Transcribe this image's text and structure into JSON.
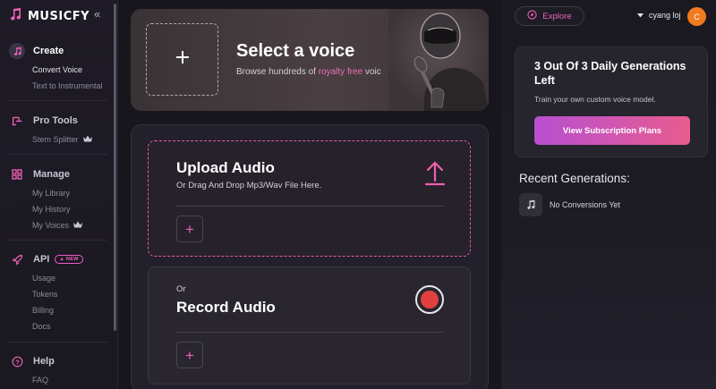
{
  "app": {
    "name": "MUSICFY"
  },
  "sidebar": {
    "sections": [
      {
        "title": "Create",
        "items": [
          "Convert Voice",
          "Text to Instrumental"
        ]
      },
      {
        "title": "Pro Tools",
        "items": [
          "Stem Splitter"
        ]
      },
      {
        "title": "Manage",
        "items": [
          "My Library",
          "My History",
          "My Voices"
        ]
      },
      {
        "title": "API",
        "badge": "NEW",
        "items": [
          "Usage",
          "Tokens",
          "Billing",
          "Docs"
        ]
      },
      {
        "title": "Help",
        "items": [
          "FAQ"
        ]
      }
    ]
  },
  "hero": {
    "title": "Select a voice",
    "subtitle_pre": "Browse hundreds of ",
    "subtitle_link": "royalty free",
    "subtitle_post": " voic"
  },
  "upload": {
    "title": "Upload Audio",
    "subtitle": "Or Drag And Drop Mp3/Wav File Here.",
    "add_label": "+"
  },
  "record": {
    "prefix": "Or",
    "title": "Record Audio",
    "add_label": "+"
  },
  "header": {
    "explore_label": "Explore",
    "username": "cyang loj",
    "avatar_initial": "C"
  },
  "generations": {
    "title": "3 Out Of 3 Daily Generations Left",
    "subtitle": "Train your own custom voice model.",
    "button_label": "View Subscription Plans"
  },
  "recent": {
    "title": "Recent Generations:",
    "empty_text": "No Conversions Yet"
  },
  "colors": {
    "accent_pink": "#ef5fb2",
    "record_red": "#e2403f",
    "avatar_orange": "#f07a1e"
  }
}
